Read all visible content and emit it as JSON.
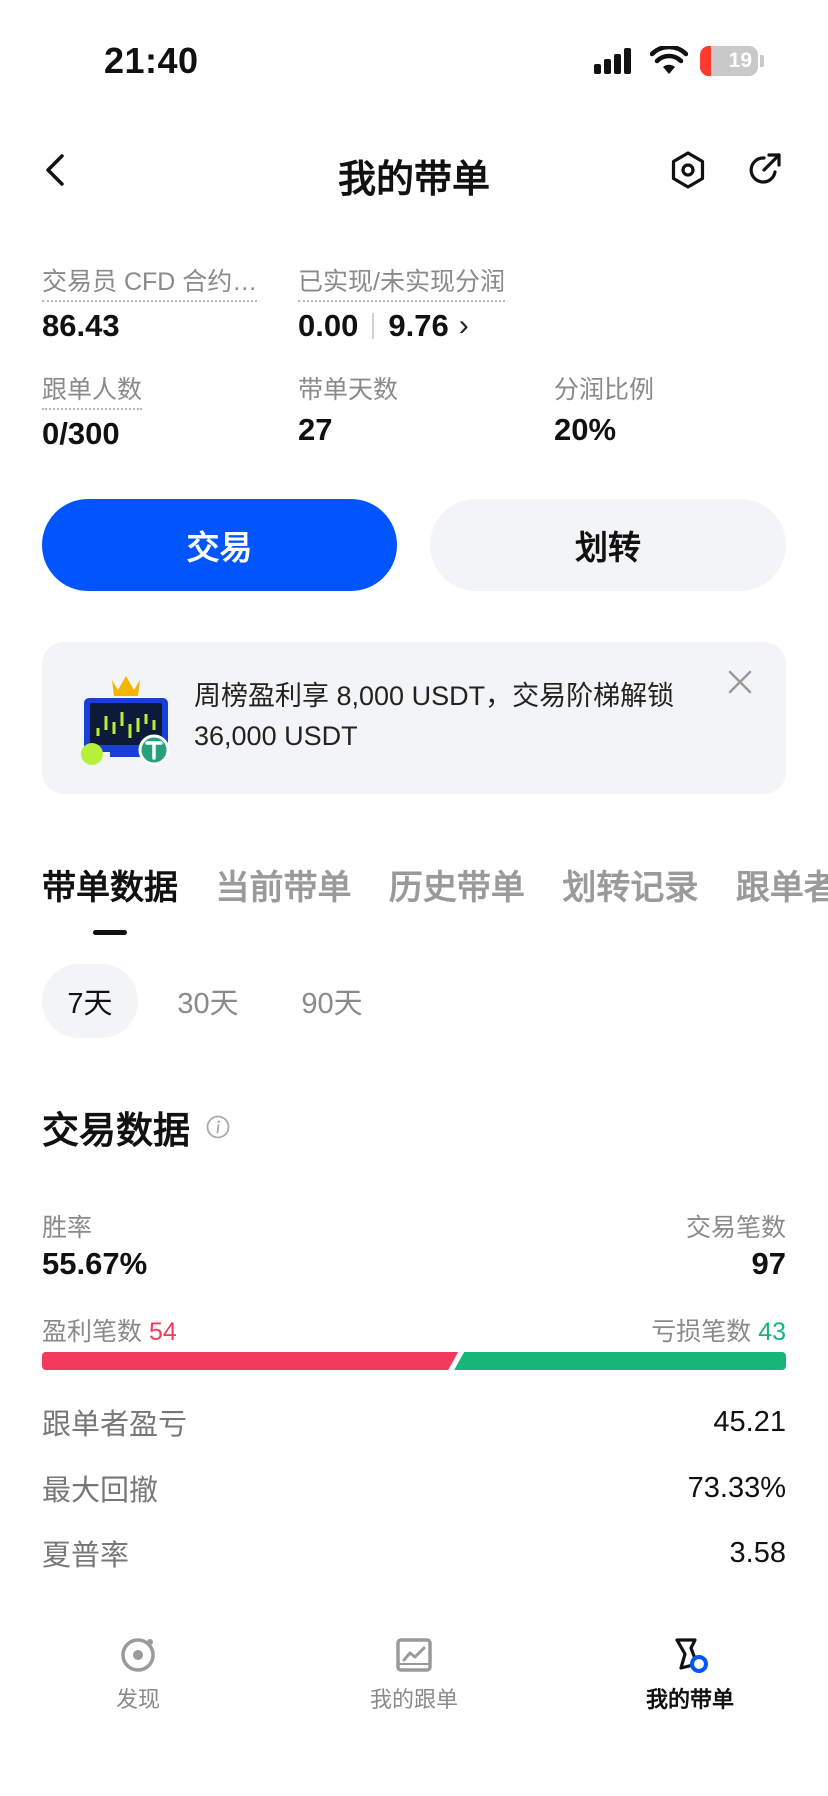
{
  "status_bar": {
    "time": "21:40",
    "battery": "19",
    "battery_level": 0.19
  },
  "header": {
    "title": "我的带单",
    "icons": [
      "back-icon",
      "settings-hexagon-icon",
      "share-icon"
    ]
  },
  "stats": {
    "trader_cfd": {
      "label": "交易员 CFD 合约…",
      "value": "86.43"
    },
    "profit_share": {
      "label": "已实现/未实现分润",
      "realized": "0.00",
      "unrealized": "9.76",
      "chevron": "›"
    },
    "followers": {
      "label": "跟单人数",
      "value": "0/300"
    },
    "days": {
      "label": "带单天数",
      "value": "27"
    },
    "share_ratio": {
      "label": "分润比例",
      "value": "20%"
    }
  },
  "actions": {
    "trade_label": "交易",
    "transfer_label": "划转"
  },
  "banner": {
    "text": "周榜盈利享 8,000 USDT，交易阶梯解锁 36,000 USDT",
    "image": "trophy-chart-icon",
    "close_icon": "close-icon"
  },
  "tabs": [
    {
      "label": "带单数据",
      "active": true
    },
    {
      "label": "当前带单",
      "active": false
    },
    {
      "label": "历史带单",
      "active": false
    },
    {
      "label": "划转记录",
      "active": false
    },
    {
      "label": "跟单者",
      "active": false
    }
  ],
  "periods": [
    {
      "label": "7天",
      "active": true
    },
    {
      "label": "30天",
      "active": false
    },
    {
      "label": "90天",
      "active": false
    }
  ],
  "trade_data": {
    "title": "交易数据",
    "win_rate_label": "胜率",
    "win_rate_value": "55.67%",
    "trades_label": "交易笔数",
    "trades_value": "97",
    "profit_label": "盈利笔数",
    "profit_count": "54",
    "loss_label": "亏损笔数",
    "loss_count": "43",
    "profit_ratio": 0.5567,
    "rows": [
      {
        "label": "跟单者盈亏",
        "value": "45.21"
      },
      {
        "label": "最大回撤",
        "value": "73.33%"
      },
      {
        "label": "夏普率",
        "value": "3.58"
      }
    ]
  },
  "colors": {
    "primary": "#0055ff",
    "profit": "#f23b5c",
    "loss": "#16b57a",
    "battery_low": "#ff3b30"
  },
  "bottom_nav": [
    {
      "label": "发现",
      "icon": "discover-icon",
      "active": false
    },
    {
      "label": "我的跟单",
      "icon": "copy-trade-icon",
      "active": false
    },
    {
      "label": "我的带单",
      "icon": "lead-trade-icon",
      "active": true
    }
  ]
}
